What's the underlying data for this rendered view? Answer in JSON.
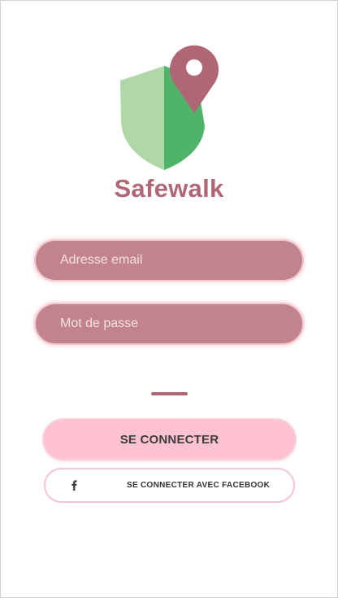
{
  "app": {
    "title": "Safewalk"
  },
  "logo": {
    "icon": "shield-location-pin-icon",
    "colors": {
      "shield_light": "#b0d7a8",
      "shield_dark": "#4fb369",
      "pin": "#b06674"
    }
  },
  "form": {
    "email_placeholder": "Adresse email",
    "password_placeholder": "Mot de passe"
  },
  "actions": {
    "login_label": "SE CONNECTER",
    "facebook_label": "SE CONNECTER AVEC FACEBOOK",
    "facebook_icon": "facebook-icon"
  },
  "colors": {
    "brand": "#b06674",
    "field_background": "#c2838e",
    "button_background": "#ffc2d0",
    "button_border": "#f7c3cf"
  }
}
